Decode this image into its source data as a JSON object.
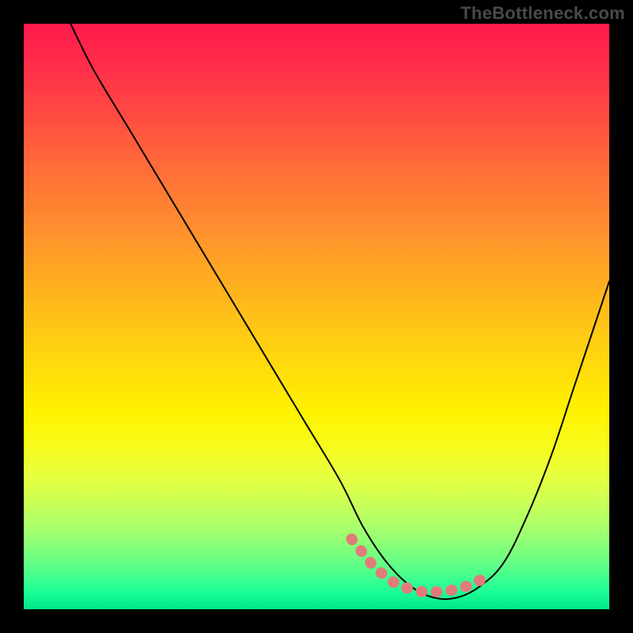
{
  "watermark": "TheBottleneck.com",
  "colors": {
    "frame_background": "#000000",
    "gradient_top": "#ff1a4d",
    "gradient_bottom": "#00e68a",
    "curve_stroke": "#000000",
    "highlight_stroke": "#e27b7b",
    "watermark_text": "#4a4a4a"
  },
  "chart_data": {
    "type": "line",
    "title": "",
    "xlabel": "",
    "ylabel": "",
    "xlim": [
      0,
      100
    ],
    "ylim": [
      0,
      100
    ],
    "grid": false,
    "legend_position": "none",
    "series": [
      {
        "name": "bottleneck-curve",
        "x": [
          8,
          12,
          18,
          24,
          30,
          36,
          42,
          48,
          54,
          58,
          62,
          66,
          70,
          74,
          78,
          82,
          86,
          90,
          94,
          98,
          100
        ],
        "values": [
          100,
          92,
          82,
          72,
          62,
          52,
          42,
          32,
          22,
          14,
          8,
          4,
          2,
          2,
          4,
          8,
          16,
          26,
          38,
          50,
          56
        ]
      },
      {
        "name": "optimal-region-highlight",
        "x": [
          56,
          60,
          64,
          68,
          72,
          76,
          80
        ],
        "values": [
          12,
          7,
          4,
          3,
          3,
          4,
          6
        ]
      }
    ],
    "annotations": [
      {
        "text": "TheBottleneck.com",
        "position": "top-right"
      }
    ]
  }
}
